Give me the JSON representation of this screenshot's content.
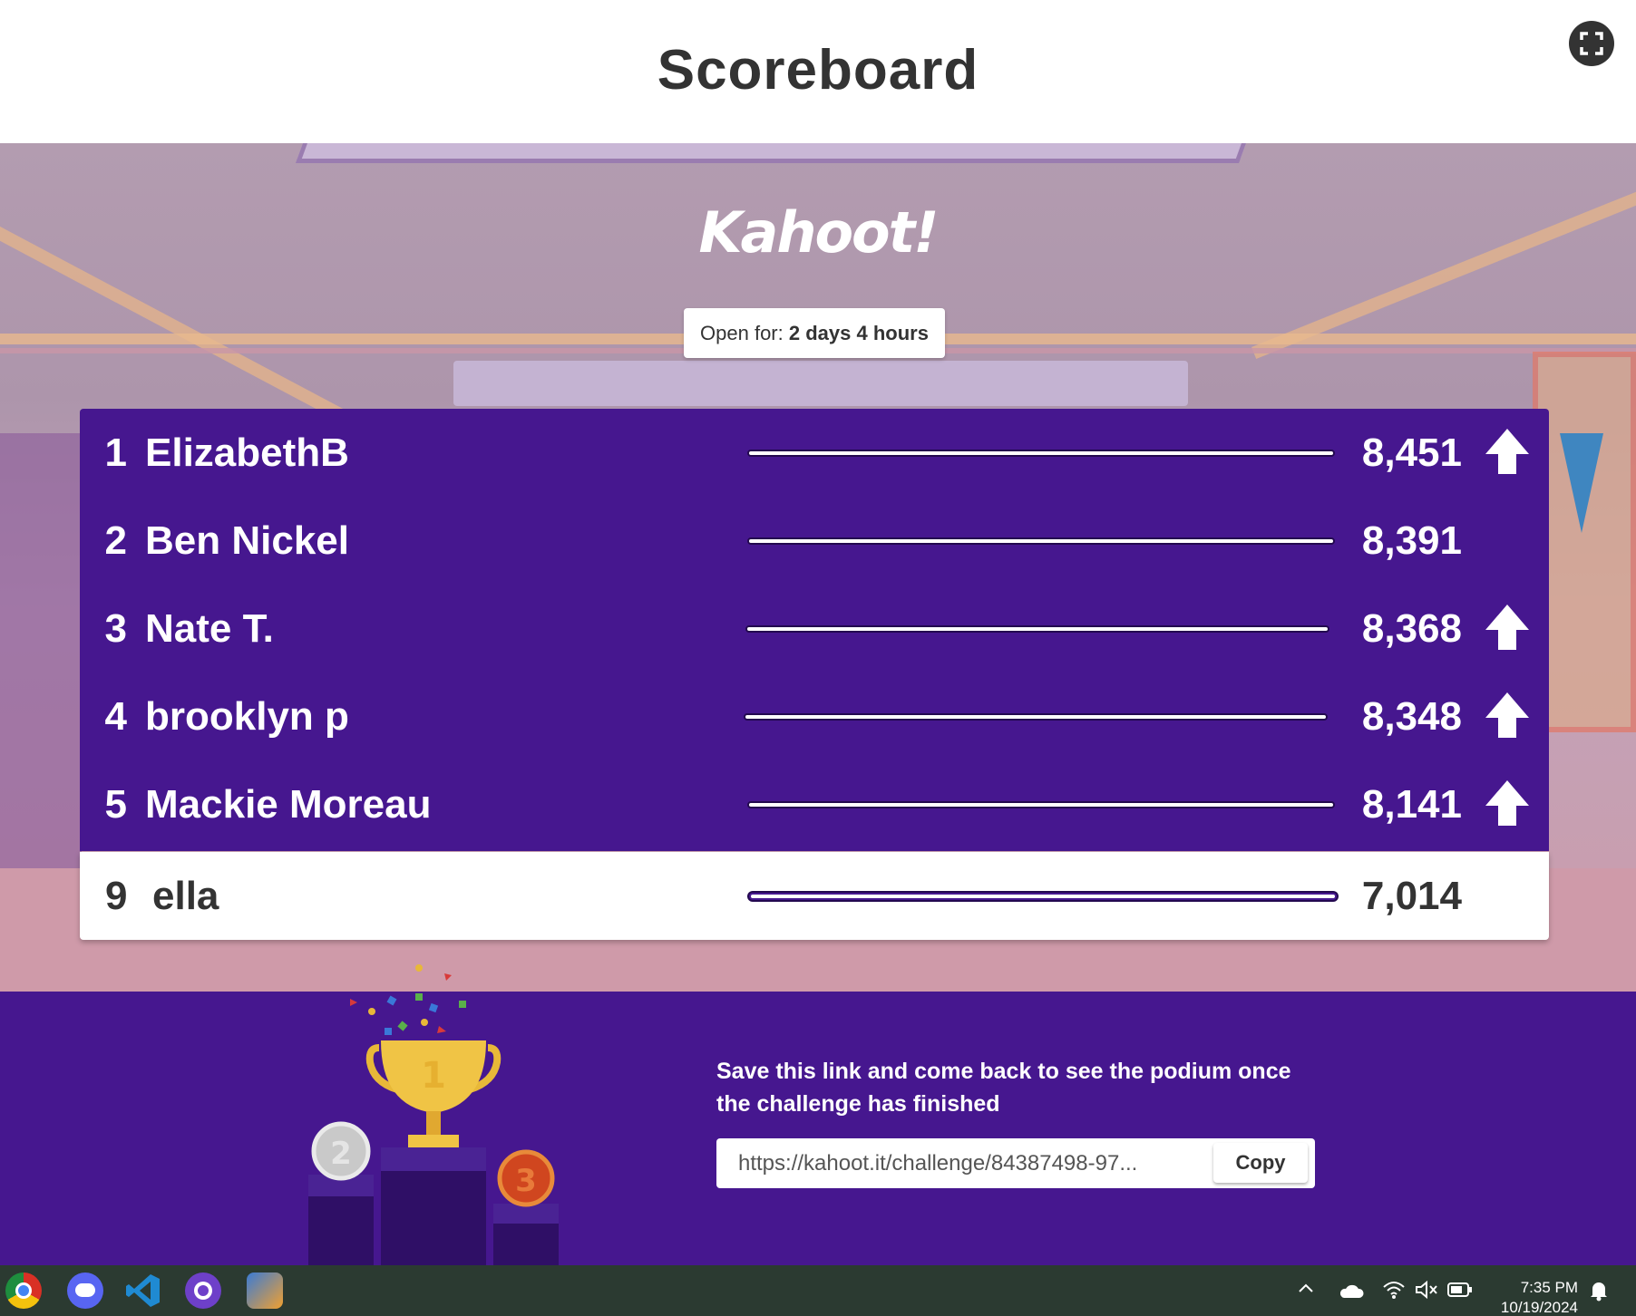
{
  "header": {
    "title": "Scoreboard",
    "fullscreen_icon": "fullscreen-icon"
  },
  "logo": {
    "text": "Kahoot!"
  },
  "open_for": {
    "label": "Open for:",
    "value": "2 days 4 hours"
  },
  "leaderboard": [
    {
      "rank": "1",
      "name": "ElizabethB",
      "score": "8,451",
      "trend": "up"
    },
    {
      "rank": "2",
      "name": "Ben Nickel",
      "score": "8,391",
      "trend": "none"
    },
    {
      "rank": "3",
      "name": "Nate T.",
      "score": "8,368",
      "trend": "up"
    },
    {
      "rank": "4",
      "name": "brooklyn p",
      "score": "8,348",
      "trend": "up"
    },
    {
      "rank": "5",
      "name": "Mackie Moreau",
      "score": "8,141",
      "trend": "up"
    }
  ],
  "current_player": {
    "rank": "9",
    "name": "ella",
    "score": "7,014"
  },
  "footer": {
    "message": "Save this link and come back to see the podium once the challenge has finished",
    "link": "https://kahoot.it/challenge/84387498-97...",
    "copy_label": "Copy",
    "podium": {
      "first": "1",
      "second": "2",
      "third": "3"
    }
  },
  "taskbar": {
    "apps": [
      "chrome-icon",
      "discord-icon",
      "vscode-icon",
      "github-desktop-icon",
      "game-icon"
    ],
    "time": "7:35 PM",
    "date": "10/19/2024"
  },
  "colors": {
    "kahoot_purple": "#46178f",
    "dark_text": "#333333",
    "taskbar": "#2b3a31"
  }
}
